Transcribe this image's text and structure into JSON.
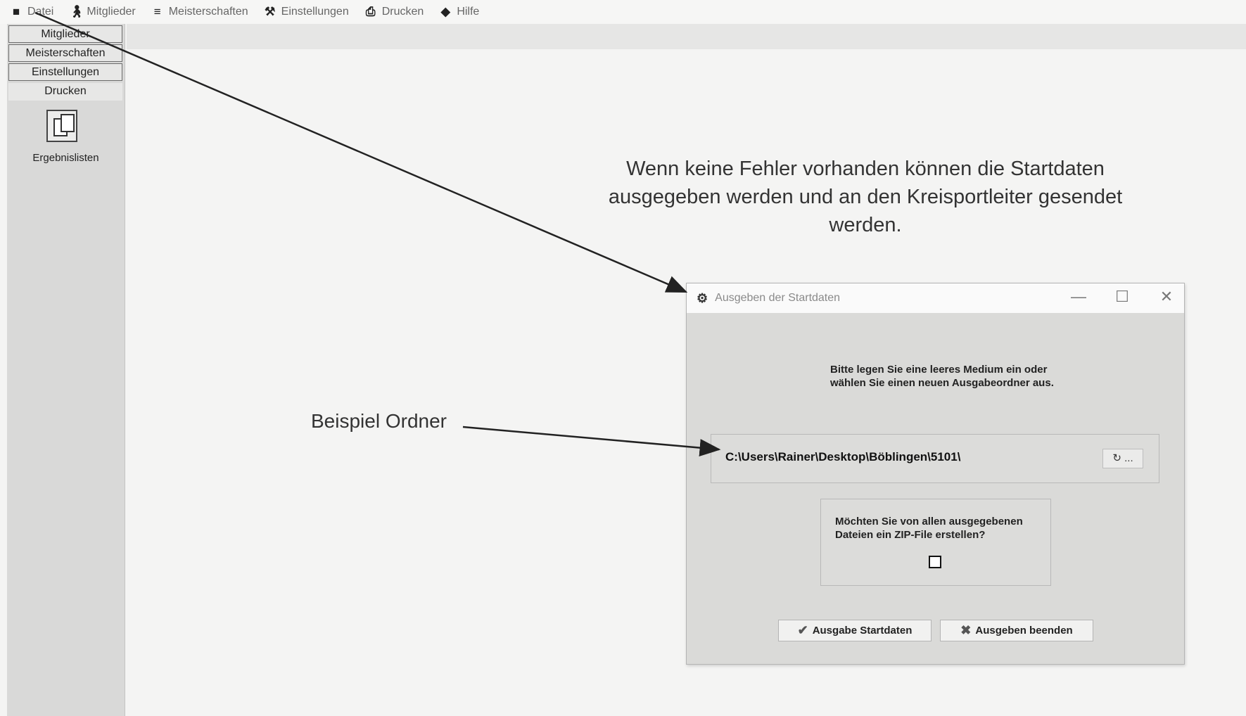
{
  "menubar": {
    "items": [
      {
        "label": "Datei",
        "icon": "save-icon"
      },
      {
        "label": "Mitglieder",
        "icon": "person-icon"
      },
      {
        "label": "Meisterschaften",
        "icon": "shooter-icon"
      },
      {
        "label": "Einstellungen",
        "icon": "tools-icon"
      },
      {
        "label": "Drucken",
        "icon": "print-icon"
      },
      {
        "label": "Hilfe",
        "icon": "help-icon"
      }
    ]
  },
  "leftpanel": {
    "buttons": [
      "Mitglieder",
      "Meisterschaften",
      "Einstellungen"
    ],
    "section_title": "Drucken",
    "tool_label": "Ergebnislisten"
  },
  "annotation": {
    "main_text": "Wenn keine Fehler vorhanden können die Startdaten ausgegeben werden und an den Kreisportleiter gesendet werden.",
    "folder_label": "Beispiel Ordner"
  },
  "dialog": {
    "title": "Ausgeben der Startdaten",
    "window_controls": {
      "minimize": "—",
      "maximize": "☐",
      "close": "✕"
    },
    "message": "Bitte legen Sie eine leeres Medium ein oder wählen Sie einen neuen Ausgabeordner aus.",
    "path_value": "C:\\Users\\Rainer\\Desktop\\Böblingen\\5101\\",
    "browse_label": "...",
    "zip_question": "Möchten Sie von allen ausgegebenen Dateien ein ZIP-File erstellen?",
    "zip_checked": false,
    "ok_button": "Ausgabe Startdaten",
    "cancel_button": "Ausgeben beenden"
  }
}
